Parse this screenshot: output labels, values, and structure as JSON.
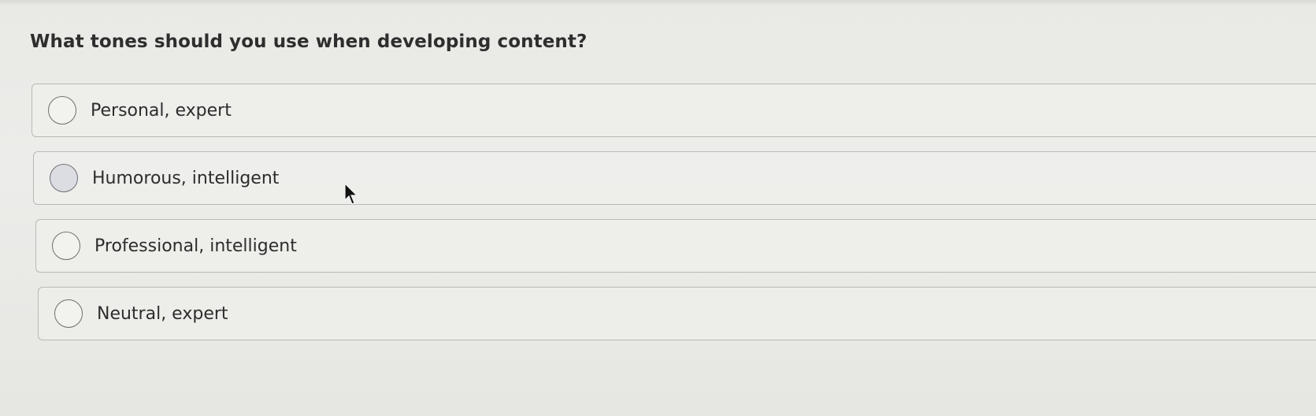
{
  "question": {
    "text": "What tones should you use when developing content?"
  },
  "options": [
    {
      "label": "Personal, expert"
    },
    {
      "label": "Humorous, intelligent"
    },
    {
      "label": "Professional, intelligent"
    },
    {
      "label": "Neutral, expert"
    }
  ],
  "icons": {
    "radio": "radio-circle-icon",
    "cursor": "mouse-pointer-icon"
  },
  "colors": {
    "background": "#e9e9e5",
    "text": "#2d2d2d",
    "option_border": "#b9b9b4",
    "radio_hover_fill": "#dcdde3"
  }
}
